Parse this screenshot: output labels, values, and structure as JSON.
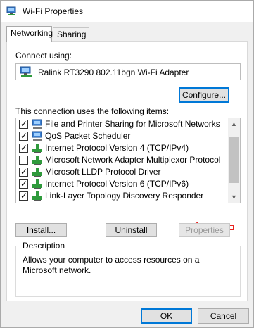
{
  "window": {
    "title": "Wi-Fi Properties",
    "icon": "network-adapter-icon"
  },
  "tabs": [
    {
      "label": "Networking",
      "active": true
    },
    {
      "label": "Sharing",
      "active": false
    }
  ],
  "connect": {
    "label": "Connect using:",
    "adapter_name": "Ralink RT3290 802.11bgn Wi-Fi Adapter",
    "configure_label": "Configure..."
  },
  "items": {
    "label": "This connection uses the following items:",
    "list": [
      {
        "label": "File and Printer Sharing for Microsoft Networks",
        "checked": true,
        "icon": "network-service-icon"
      },
      {
        "label": "QoS Packet Scheduler",
        "checked": true,
        "icon": "network-service-icon"
      },
      {
        "label": "Internet Protocol Version 4 (TCP/IPv4)",
        "checked": true,
        "icon": "protocol-icon"
      },
      {
        "label": "Microsoft Network Adapter Multiplexor Protocol",
        "checked": false,
        "icon": "protocol-icon"
      },
      {
        "label": "Microsoft LLDP Protocol Driver",
        "checked": true,
        "icon": "protocol-icon"
      },
      {
        "label": "Internet Protocol Version 6 (TCP/IPv6)",
        "checked": true,
        "icon": "protocol-icon"
      },
      {
        "label": "Link-Layer Topology Discovery Responder",
        "checked": true,
        "icon": "protocol-icon"
      }
    ]
  },
  "buttons": {
    "install": "Install...",
    "uninstall": "Uninstall",
    "properties": "Properties",
    "ok": "OK",
    "cancel": "Cancel"
  },
  "description": {
    "title": "Description",
    "text": "Allows your computer to access resources on a Microsoft network."
  },
  "colors": {
    "annotation_arrow": "#e8231f",
    "focus_border": "#0078d7",
    "protocol_green": "#2f9a3c",
    "service_blue": "#3c7fd0"
  }
}
